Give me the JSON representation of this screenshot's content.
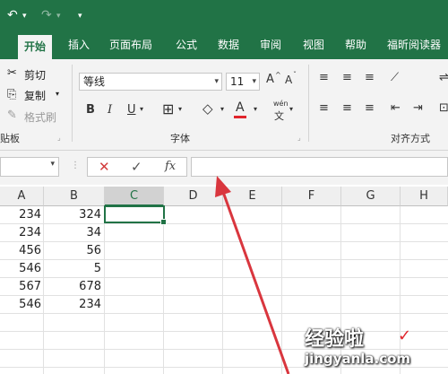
{
  "quick_access": {
    "undo": "↶",
    "undo_dd": "▾",
    "redo": "↷",
    "redo_dd": "▾",
    "customize": "▾"
  },
  "tabs": [
    "开始",
    "插入",
    "页面布局",
    "公式",
    "数据",
    "审阅",
    "视图",
    "帮助",
    "福昕阅读器"
  ],
  "clipboard": {
    "cut": "剪切",
    "copy": "复制",
    "format_painter": "格式刷",
    "group": "贴板"
  },
  "font": {
    "name": "等线",
    "size": "11",
    "group": "字体",
    "grow": "A",
    "shrink": "A",
    "bold": "B",
    "italic": "I",
    "underline": "U",
    "font_color": "A",
    "phonetic": "wén"
  },
  "alignment": {
    "group": "对齐方式"
  },
  "formula_bar": {
    "cancel": "✕",
    "enter": "✓",
    "fx": "fx",
    "value": ""
  },
  "columns": [
    "A",
    "B",
    "C",
    "D",
    "E",
    "F",
    "G",
    "H"
  ],
  "rows": [
    [
      "234",
      "324"
    ],
    [
      "234",
      "34"
    ],
    [
      "456",
      "56"
    ],
    [
      "546",
      "5"
    ],
    [
      "567",
      "678"
    ],
    [
      "546",
      "234"
    ]
  ],
  "watermark": {
    "line1": "经验啦",
    "line2": "jingyanla.com",
    "check": "✓"
  },
  "colors": {
    "excel_green": "#217346",
    "arrow": "#d9363e"
  }
}
